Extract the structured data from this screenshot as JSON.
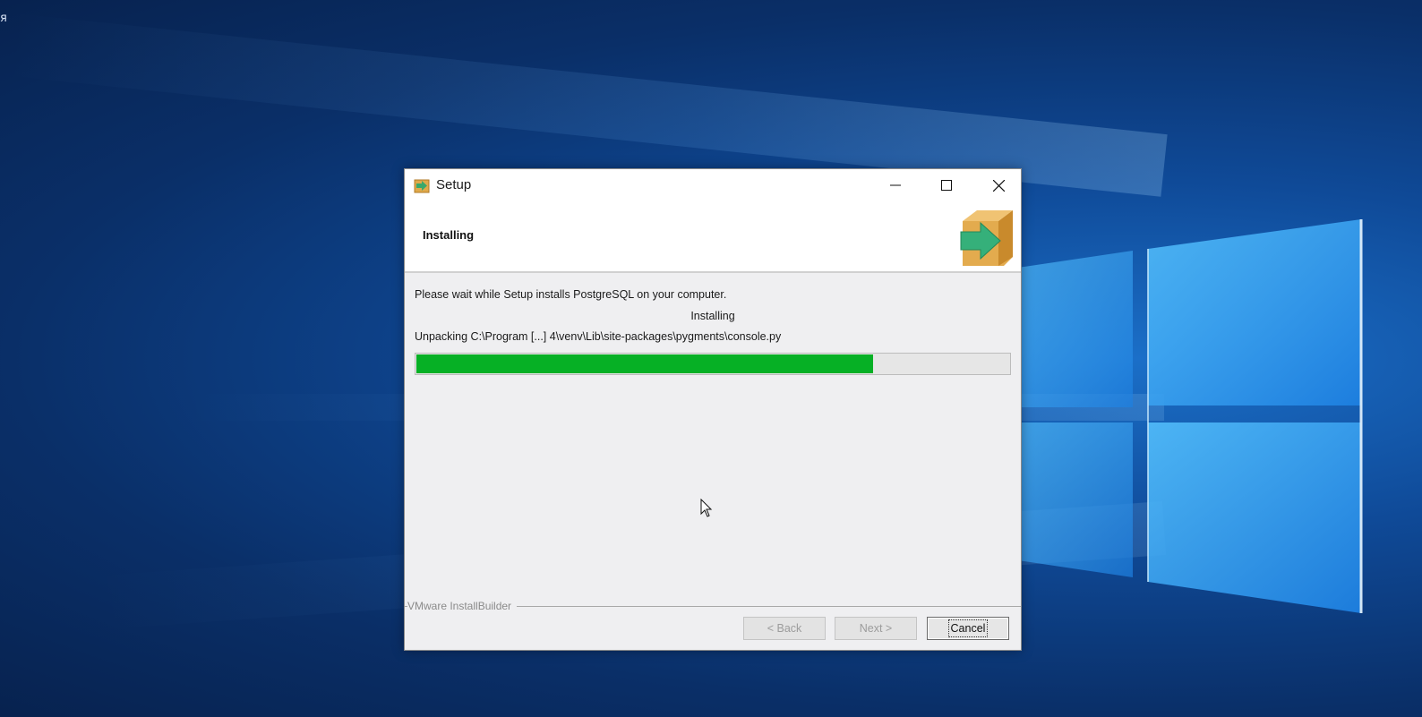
{
  "desktop": {
    "corner_text": "я",
    "colors": {
      "background": "#0a2f68",
      "logo": "#3fb2ff"
    }
  },
  "window": {
    "title": "Setup",
    "icon": "setup-arrow-box-icon",
    "controls": {
      "minimize": "minimize-icon",
      "maximize": "maximize-icon",
      "close": "close-icon"
    },
    "header": {
      "title": "Installing",
      "logo": "installer-arrow-box-icon"
    },
    "body": {
      "wait_message": "Please wait while Setup installs PostgreSQL on your computer.",
      "status": "Installing",
      "current_file": "Unpacking C:\\Program [...] 4\\venv\\Lib\\site-packages\\pygments\\console.py",
      "progress_fraction": 0.77,
      "progress_color": "#06b025"
    },
    "branding": "VMware InstallBuilder",
    "buttons": {
      "back": "< Back",
      "next": "Next >",
      "cancel": "Cancel"
    }
  }
}
